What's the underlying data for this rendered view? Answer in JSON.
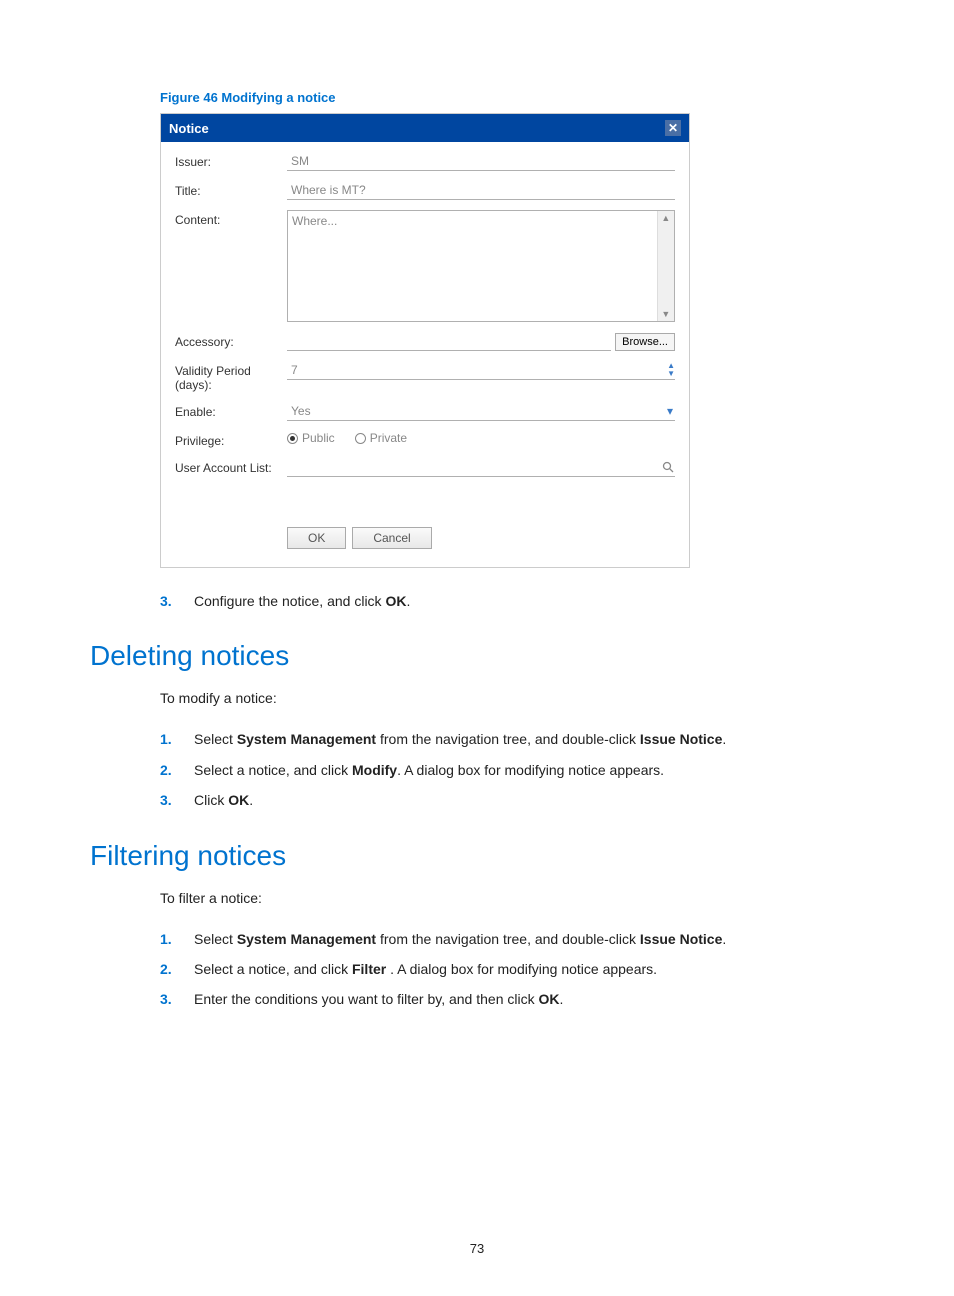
{
  "figure_caption": "Figure 46 Modifying a notice",
  "dialog": {
    "title": "Notice",
    "labels": {
      "issuer": "Issuer:",
      "title": "Title:",
      "content": "Content:",
      "accessory": "Accessory:",
      "validity": "Validity Period (days):",
      "enable": "Enable:",
      "privilege": "Privilege:",
      "userlist": "User Account List:"
    },
    "values": {
      "issuer": "SM",
      "title": "Where is MT?",
      "content": "Where...",
      "validity": "7",
      "enable": "Yes"
    },
    "privilege": {
      "public": "Public",
      "private": "Private",
      "selected": "public"
    },
    "browse_label": "Browse...",
    "ok_label": "OK",
    "cancel_label": "Cancel"
  },
  "post_step": {
    "num": "3.",
    "text_before": "Configure the notice, and click ",
    "bold1": "OK",
    "text_after": "."
  },
  "section_delete": {
    "heading": "Deleting notices",
    "intro": "To modify a notice:",
    "steps": [
      {
        "num": "1.",
        "parts": [
          {
            "t": "Select "
          },
          {
            "b": "System Management"
          },
          {
            "t": " from the navigation tree, and double-click "
          },
          {
            "b": "Issue Notice"
          },
          {
            "t": "."
          }
        ]
      },
      {
        "num": "2.",
        "parts": [
          {
            "t": "Select a notice, and click "
          },
          {
            "b": "Modify"
          },
          {
            "t": ". A dialog box for modifying notice appears."
          }
        ]
      },
      {
        "num": "3.",
        "parts": [
          {
            "t": "Click "
          },
          {
            "b": "OK"
          },
          {
            "t": "."
          }
        ]
      }
    ]
  },
  "section_filter": {
    "heading": "Filtering notices",
    "intro": "To filter a notice:",
    "steps": [
      {
        "num": "1.",
        "parts": [
          {
            "t": "Select "
          },
          {
            "b": "System Management"
          },
          {
            "t": " from the navigation tree, and double-click "
          },
          {
            "b": "Issue Notice"
          },
          {
            "t": "."
          }
        ]
      },
      {
        "num": "2.",
        "parts": [
          {
            "t": "Select a notice, and click "
          },
          {
            "b": "Filter"
          },
          {
            "t": " . A dialog box for modifying notice appears."
          }
        ]
      },
      {
        "num": "3.",
        "parts": [
          {
            "t": "Enter the conditions you want to filter by, and then click "
          },
          {
            "b": "OK"
          },
          {
            "t": "."
          }
        ]
      }
    ]
  },
  "page_number": "73"
}
